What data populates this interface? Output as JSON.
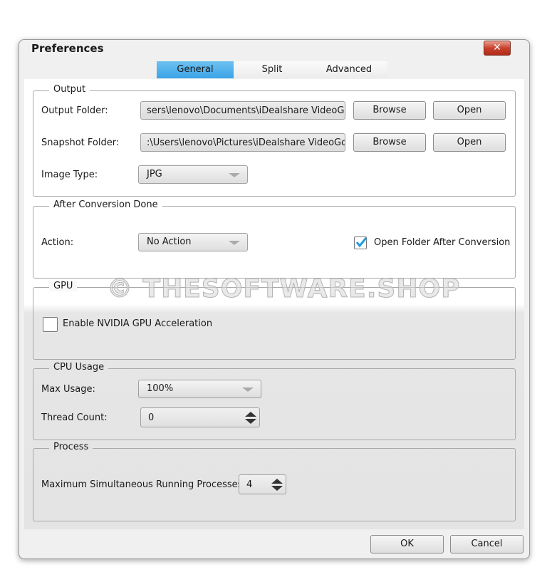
{
  "window": {
    "title": "Preferences",
    "close_icon": "close-icon"
  },
  "tabs": [
    {
      "label": "General",
      "active": true
    },
    {
      "label": "Split"
    },
    {
      "label": "Advanced"
    }
  ],
  "output": {
    "legend": "Output",
    "output_folder_label": "Output Folder:",
    "output_folder_value": "sers\\lenovo\\Documents\\iDealshare VideoGo",
    "snapshot_folder_label": "Snapshot Folder:",
    "snapshot_folder_value": ":\\Users\\lenovo\\Pictures\\iDealshare VideoGo",
    "browse": "Browse",
    "open": "Open",
    "image_type_label": "Image Type:",
    "image_type_value": "JPG"
  },
  "after": {
    "legend": "After Conversion Done",
    "action_label": "Action:",
    "action_value": "No Action",
    "open_folder_label": "Open Folder After Conversion",
    "open_folder_checked": true
  },
  "gpu": {
    "legend": "GPU",
    "enable_label": "Enable NVIDIA GPU Acceleration",
    "enable_checked": false
  },
  "cpu": {
    "legend": "CPU Usage",
    "max_label": "Max Usage:",
    "max_value": "100%",
    "thread_label": "Thread Count:",
    "thread_value": "0"
  },
  "process": {
    "legend": "Process",
    "max_label": "Maximum Simultaneous Running Processes:",
    "max_value": "4"
  },
  "footer": {
    "ok": "OK",
    "cancel": "Cancel"
  },
  "watermark": "© THESOFTWARE.SHOP",
  "colors": {
    "active_tab": "#3aa4e6",
    "close_button": "#c8412c",
    "check": "#1e9be0"
  }
}
